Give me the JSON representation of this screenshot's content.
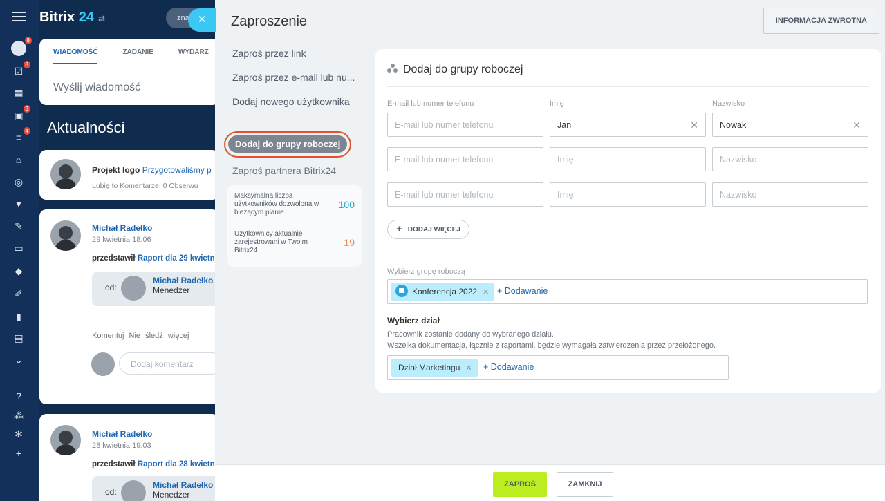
{
  "background": {
    "brand": {
      "name": "Bitrix",
      "num": "24"
    },
    "search_placeholder": "zna",
    "poster": {
      "tabs": [
        "WIADOMOŚĆ",
        "ZADANIE",
        "WYDARZ"
      ],
      "message_placeholder": "Wyślij wiadomość"
    },
    "section_title": "Aktualności",
    "post0": {
      "author": "Projekt logo",
      "text": "Przygotowaliśmy p",
      "meta": "Lubię to  Komentarze: 0  Obserwu"
    },
    "post1": {
      "author": "Michał Radełko",
      "date": "29 kwietnia 18:06",
      "line_prefix": "przedstawił",
      "line_link": "Raport dla 29 kwietnia",
      "od": "od:",
      "od_name": "Michał Radełko",
      "od_role": "Menedżer",
      "actions": "Komentuj  Nie śledź  więcej",
      "comment_placeholder": "Dodaj komentarz"
    },
    "post2": {
      "author": "Michał Radełko",
      "date": "28 kwietnia 19:03",
      "line_prefix": "przedstawił",
      "line_link": "Raport dla 28 kwietnia",
      "od": "od:",
      "od_name": "Michał Radełko",
      "od_role": "Menedżer"
    },
    "rail_badges": [
      "8",
      "8",
      "3",
      "4"
    ]
  },
  "slider": {
    "title": "Zaproszenie",
    "feedback_button": "INFORMACJA ZWROTNA",
    "close_icon": "close-icon"
  },
  "menu": {
    "items": [
      "Zaproś przez link",
      "Zaproś przez e-mail lub nu...",
      "Dodaj nowego użytkownika"
    ],
    "selected": "Dodaj do grupy roboczej",
    "partner": "Zaproś partnera Bitrix24"
  },
  "stats": {
    "max_label": "Maksymalna liczba użytkowników dozwolona w bieżącym planie",
    "max_value": "100",
    "current_label": "Użytkownicy aktualnie zarejestrowani w Twoim Bitrix24",
    "current_value": "19"
  },
  "form": {
    "header": "Dodaj do grupy roboczej",
    "col_email": "E-mail lub numer telefonu",
    "col_name": "Imię",
    "col_surname": "Nazwisko",
    "rows": [
      {
        "email": "",
        "name": "Jan",
        "surname": "Nowak"
      },
      {
        "email": "",
        "name": "",
        "surname": ""
      },
      {
        "email": "",
        "name": "",
        "surname": ""
      }
    ],
    "placeholder_email": "E-mail lub numer telefonu",
    "placeholder_name": "Imię",
    "placeholder_surname": "Nazwisko",
    "add_more": "DODAJ WIĘCEJ",
    "group_label": "Wybierz grupę roboczą",
    "group_tag": "Konferencja 2022",
    "add_link": "+ Dodawanie",
    "dept_title": "Wybierz dział",
    "dept_desc_1": "Pracownik zostanie dodany do wybranego działu.",
    "dept_desc_2": "Wszelka dokumentacja, łącznie z raportami, będzie wymagała zatwierdzenia przez przełożonego.",
    "dept_tag": "Dział Marketingu"
  },
  "footer": {
    "invite": "ZAPROŚ",
    "close": "ZAMKNIJ"
  },
  "colors": {
    "accent": "#2067b0",
    "invite_button": "#bbed21",
    "highlight": "#e05328",
    "tag_bg": "#bcedfc"
  }
}
